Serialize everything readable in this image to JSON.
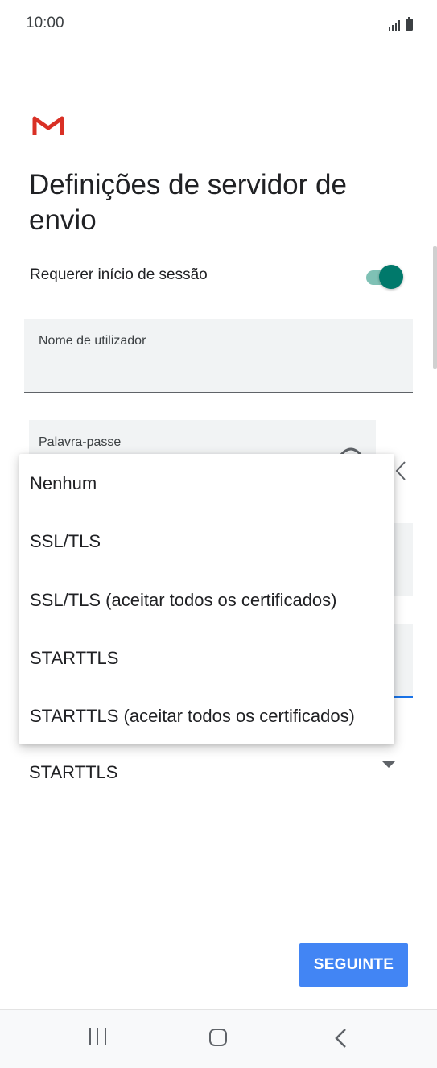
{
  "status_bar": {
    "time": "10:00"
  },
  "header": {
    "title": "Definições de servidor de envio"
  },
  "settings": {
    "require_signin_label": "Requerer início de sessão",
    "require_signin_on": true
  },
  "fields": {
    "username_label": "Nome de utilizador",
    "password_label": "Palavra-passe"
  },
  "security": {
    "selected": "STARTTLS"
  },
  "security_menu": {
    "options": [
      "Nenhum",
      "SSL/TLS",
      "SSL/TLS (aceitar todos os certificados)",
      "STARTTLS",
      "STARTTLS (aceitar todos os certificados)"
    ]
  },
  "actions": {
    "next_label": "SEGUINTE"
  },
  "colors": {
    "accent": "#00796b",
    "button": "#4285f4",
    "gmail_red": "#d93025"
  },
  "icons": {
    "app": "gmail-icon",
    "password_toggle": "eye-off-icon",
    "back": "chevron-left-icon"
  }
}
